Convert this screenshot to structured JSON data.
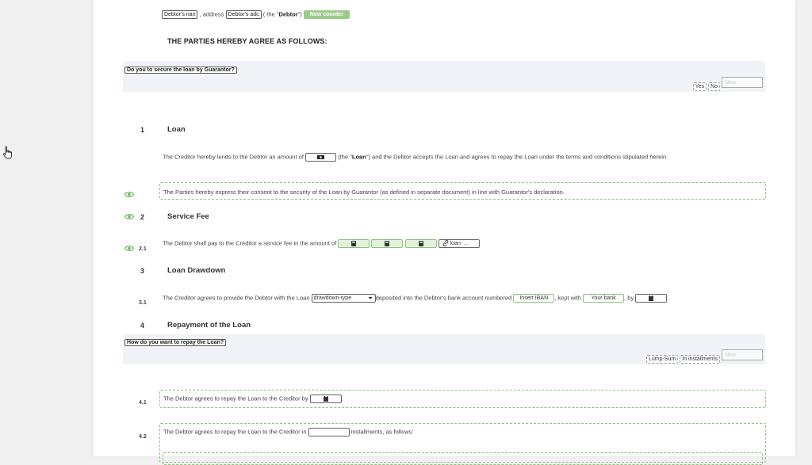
{
  "header_row": {
    "debtor_name_field": "Debtor's nan",
    "address_text": ", address",
    "debtor_address_field": "Debtor's adc",
    "the_quote_prefix": "( the \"",
    "debtor_label": "Debtor",
    "the_quote_suffix": "\")",
    "new_counter_button": "New counter"
  },
  "agree_heading": "THE PARTIES HEREBY AGREE AS FOLLOWS:",
  "guarantor_question": {
    "label": "Do you to secure the loan by Guarantor?",
    "options": [
      "Yes",
      "No"
    ],
    "new_response": "New response"
  },
  "sections": {
    "s1": {
      "number": "1",
      "title": "Loan",
      "text_before": "The Creditor hereby lends to the Debtor an amount of",
      "text_mid": "(the \"",
      "loan_word": "Loan",
      "text_after": "\") and the Debtor accepts the Loan and agrees to repay the Loan under the terms and conditions stipulated herein.",
      "guarantor_text": "The Parties hereby express their consent to the security of the Loan by Guarantor (as defined in separate document) in line with Guarantor's declaration."
    },
    "s2": {
      "number": "2",
      "title": "Service Fee",
      "sub_number": "2.1",
      "text": "The Debtor shall pay to the Creditor a service fee in the amount of",
      "link_field": "loan- ..."
    },
    "s3": {
      "number": "3",
      "title": "Loan Drawdown",
      "sub_number": "3.1",
      "text_before": "The Creditor agrees to provide the Debtor with the Loan",
      "select_value": "drawdown-type",
      "text_mid": "deposited into the Debtor's bank account numbered",
      "iban_field": "Insert IBAN",
      "kept_with": ", kept with",
      "bank_field": "Your bank",
      "by_text": ", by",
      "end_period": "."
    },
    "s4": {
      "number": "4",
      "title": "Repayment of the Loan",
      "question_label": "How do you want to repay the Loan?",
      "options": [
        "Lump-Sum",
        "In installments"
      ],
      "new_response": "New response",
      "sub1_number": "4.1",
      "sub1_text": "The Debtor agrees to repay the Loan to the Creditor by",
      "sub1_end": ".",
      "sub2_number": "4.2",
      "sub2_text_before": "The Debtor agrees to repay the Loan to the Creditor in",
      "sub2_text_after": "installments, as follows:"
    }
  },
  "colors": {
    "accent_green": "#9ccc8c",
    "field_green_bg": "#e3f1dc",
    "band_bg": "#f0f4f9"
  },
  "icons": [
    "hand-cursor-icon",
    "eye-icon",
    "money-icon",
    "calculator-icon",
    "calendar-icon",
    "link-icon",
    "chevron-down-icon"
  ]
}
